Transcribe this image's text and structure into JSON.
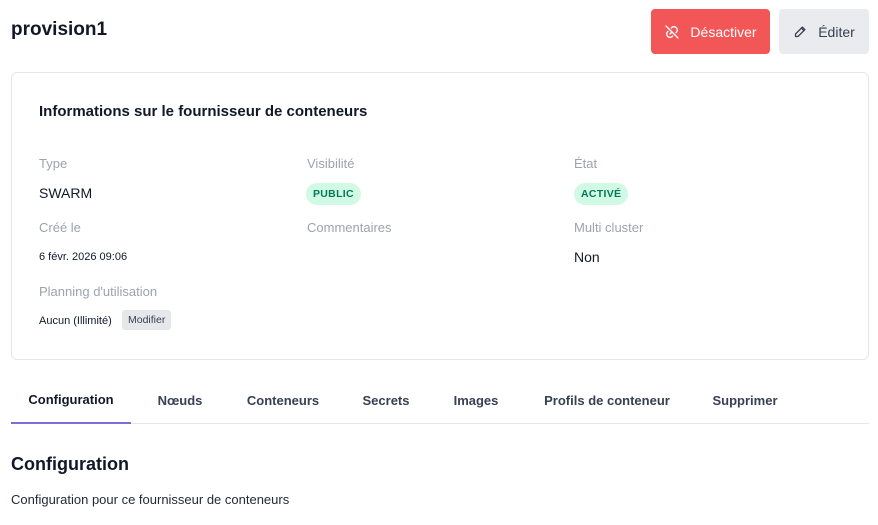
{
  "header": {
    "title": "provision1",
    "deactivate_label": "Désactiver",
    "edit_label": "Éditer"
  },
  "card": {
    "title": "Informations sur le fournisseur de conteneurs",
    "type_label": "Type",
    "type_value": "SWARM",
    "visibility_label": "Visibilité",
    "visibility_value": "PUBLIC",
    "state_label": "État",
    "state_value": "ACTIVÉ",
    "created_label": "Créé le",
    "created_value": "6 févr. 2026 09:06",
    "comments_label": "Commentaires",
    "multicluster_label": "Multi cluster",
    "multicluster_value": "Non",
    "planning_label": "Planning d'utilisation",
    "planning_value": "Aucun (Illimité)",
    "modify_label": "Modifier"
  },
  "tabs": [
    {
      "label": "Configuration",
      "active": true
    },
    {
      "label": "Nœuds"
    },
    {
      "label": "Conteneurs"
    },
    {
      "label": "Secrets"
    },
    {
      "label": "Images"
    },
    {
      "label": "Profils de conteneur"
    },
    {
      "label": "Supprimer"
    }
  ],
  "section": {
    "title": "Configuration",
    "description": "Configuration pour ce fournisseur de conteneurs"
  },
  "colors": {
    "danger": "#f25656",
    "badge_bg": "#d1fae5",
    "badge_text": "#047857",
    "tab_accent": "#7c6fd6"
  },
  "icons": {
    "deactivate": "link-off-icon",
    "edit": "pencil-icon"
  }
}
